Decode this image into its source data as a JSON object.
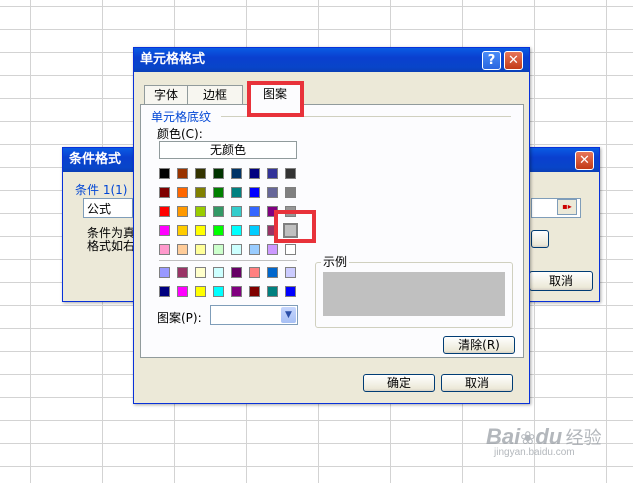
{
  "cond_dialog": {
    "title": "条件格式",
    "condition_label": "条件 1(1)",
    "type_value": "公式",
    "desc_line1": "条件为真",
    "desc_line2": "格式如右",
    "cancel_label": "取消"
  },
  "main_dialog": {
    "title": "单元格格式",
    "help_glyph": "?",
    "close_glyph": "✕",
    "tabs": [
      "字体",
      "边框",
      "图案"
    ],
    "active_tab": "图案",
    "group_label": "单元格底纹",
    "color_label": "颜色(C):",
    "no_color_label": "无颜色",
    "pattern_label": "图案(P):",
    "sample_label": "示例",
    "clear_label": "清除(R)",
    "ok_label": "确定",
    "cancel_label": "取消",
    "selected_color": "#c0c0c0",
    "palette": [
      [
        "#000000",
        "#993300",
        "#333300",
        "#003300",
        "#003366",
        "#000080",
        "#333399",
        "#333333"
      ],
      [
        "#800000",
        "#ff6600",
        "#808000",
        "#008000",
        "#008080",
        "#0000ff",
        "#666699",
        "#808080"
      ],
      [
        "#ff0000",
        "#ff9900",
        "#99cc00",
        "#339966",
        "#33cccc",
        "#3366ff",
        "#800080",
        "#969696"
      ],
      [
        "#ff00ff",
        "#ffcc00",
        "#ffff00",
        "#00ff00",
        "#00ffff",
        "#00ccff",
        "#993366",
        "#c0c0c0"
      ],
      [
        "#ff99cc",
        "#ffcc99",
        "#ffff99",
        "#ccffcc",
        "#ccffff",
        "#99ccff",
        "#cc99ff",
        "#ffffff"
      ]
    ],
    "palette_extra": [
      [
        "#9999ff",
        "#993366",
        "#ffffcc",
        "#ccffff",
        "#660066",
        "#ff8080",
        "#0066cc",
        "#ccccff"
      ],
      [
        "#000080",
        "#ff00ff",
        "#ffff00",
        "#00ffff",
        "#800080",
        "#800000",
        "#008080",
        "#0000ff"
      ]
    ]
  },
  "watermark": {
    "brand": "Bai",
    "brand2": "du",
    "suffix": "经验",
    "url": "jingyan.baidu.com"
  }
}
